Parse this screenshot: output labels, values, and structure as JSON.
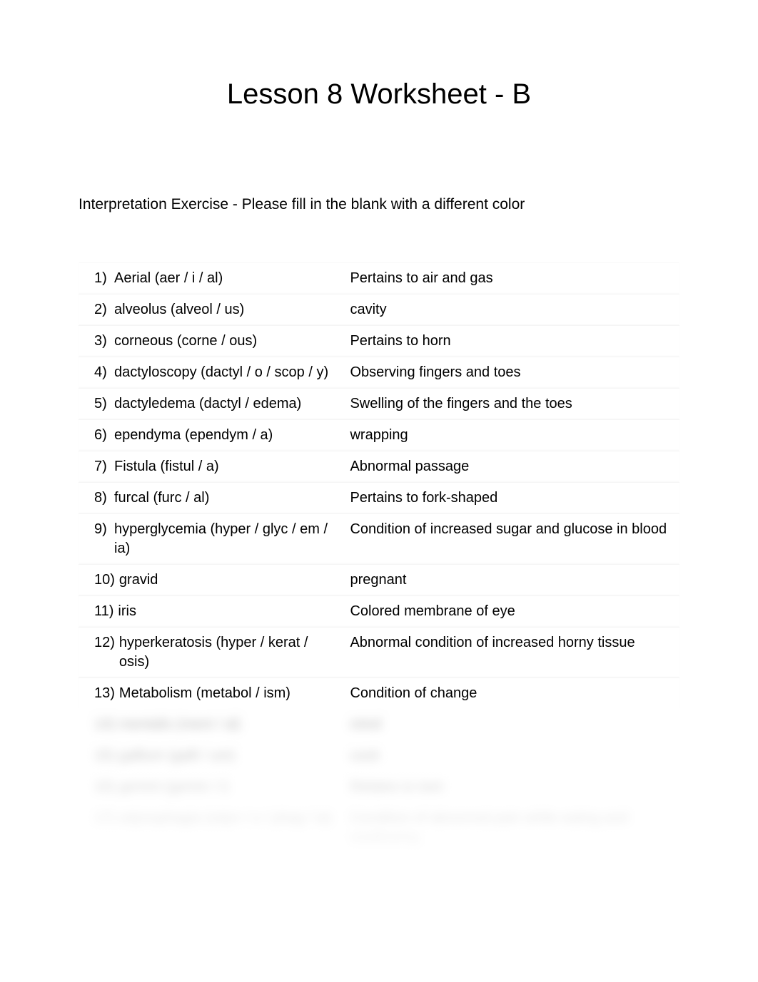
{
  "title": "Lesson 8 Worksheet - B",
  "instruction": "Interpretation Exercise - Please fill in the blank with a different color",
  "rows": [
    {
      "num": "1)",
      "term": "Aerial (aer / i / al)",
      "def": "Pertains to air and gas"
    },
    {
      "num": "2)",
      "term": "alveolus (alveol / us)",
      "def": "cavity"
    },
    {
      "num": "3)",
      "term": "corneous (corne / ous)",
      "def": "Pertains to horn"
    },
    {
      "num": "4)",
      "term": "dactyloscopy  (dactyl / o / scop / y)",
      "def": "Observing fingers and toes"
    },
    {
      "num": "5)",
      "term": "dactyledema (dactyl / edema)",
      "def": "Swelling of the fingers and the toes"
    },
    {
      "num": "6)",
      "term": "ependyma (ependym / a)",
      "def": "wrapping"
    },
    {
      "num": "7)",
      "term": "Fistula (fistul / a)",
      "def": "Abnormal passage"
    },
    {
      "num": "8)",
      "term": "furcal (furc / al)",
      "def": "Pertains to fork-shaped"
    },
    {
      "num": "9)",
      "term": "hyperglycemia (hyper / glyc / em / ia)",
      "def": "Condition of increased sugar and glucose in blood"
    },
    {
      "num": "10)",
      "term": "gravid",
      "def": "pregnant"
    },
    {
      "num": "11)",
      "term": "iris",
      "def": "Colored membrane of eye"
    },
    {
      "num": "12)",
      "term": "hyperkeratosis (hyper / kerat / osis)",
      "def": "Abnormal condition of increased horny tissue"
    },
    {
      "num": "13)",
      "term": "Metabolism (metabol / ism)",
      "def": "Condition of change"
    }
  ],
  "blurred_rows": [
    {
      "num": "14)",
      "term": "mentalis (ment / al)",
      "def": "mind"
    },
    {
      "num": "15)",
      "term": "gallium (galli / um)",
      "def": "cock"
    },
    {
      "num": "16)",
      "term": "gemini (gemin / i)",
      "def": "Relates to twin"
    },
    {
      "num": "17)",
      "term": "odynophagia (odyn / o / phag / ia)",
      "def": "Condition of abnormal pain while eating and swallowing"
    }
  ]
}
